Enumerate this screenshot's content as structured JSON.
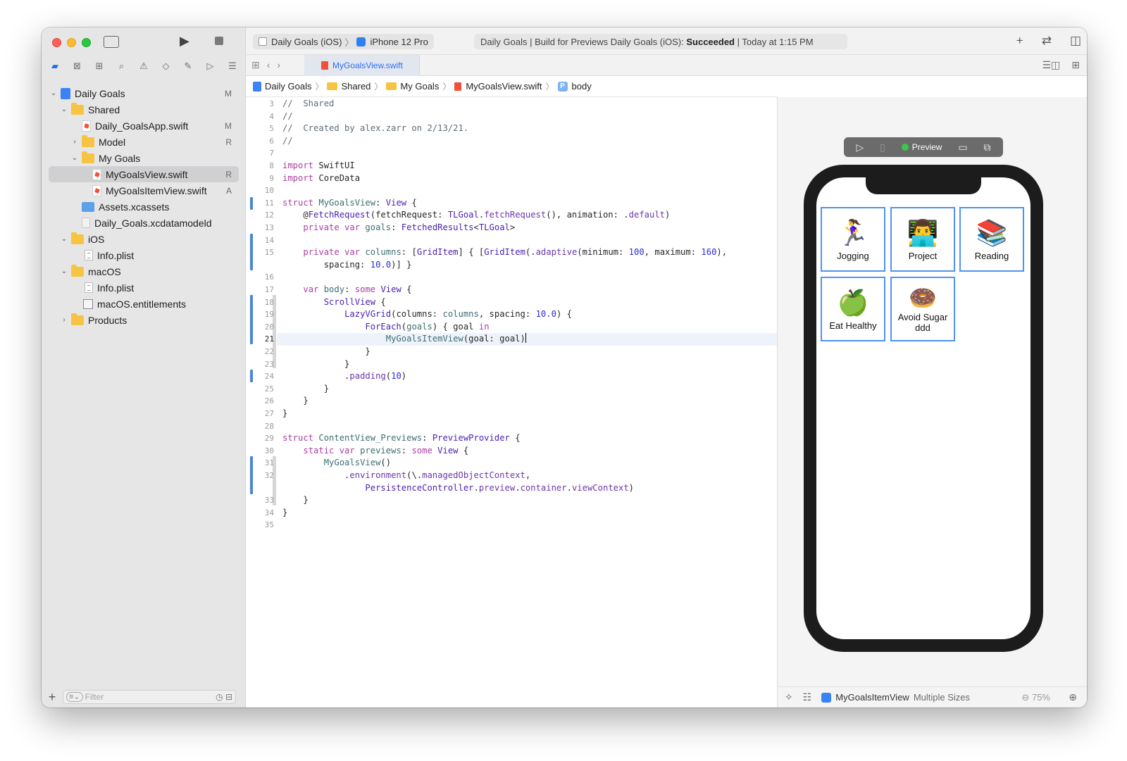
{
  "sidebar": {
    "nav_icons": [
      "folder-icon",
      "source-control-icon",
      "symbol-icon",
      "find-icon",
      "issue-icon",
      "test-icon",
      "debug-icon",
      "breakpoint-icon",
      "report-icon"
    ],
    "tree": [
      {
        "label": "Daily Goals",
        "badge": "M",
        "icon": "project-icon"
      },
      {
        "label": "Shared",
        "badge": "",
        "icon": "folder-icon"
      },
      {
        "label": "Daily_GoalsApp.swift",
        "badge": "M",
        "icon": "swift-file-icon"
      },
      {
        "label": "Model",
        "badge": "R",
        "icon": "folder-icon"
      },
      {
        "label": "My Goals",
        "badge": "",
        "icon": "folder-icon"
      },
      {
        "label": "MyGoalsView.swift",
        "badge": "R",
        "icon": "swift-file-icon"
      },
      {
        "label": "MyGoalsItemView.swift",
        "badge": "A",
        "icon": "swift-file-icon"
      },
      {
        "label": "Assets.xcassets",
        "badge": "",
        "icon": "assets-icon"
      },
      {
        "label": "Daily_Goals.xcdatamodeld",
        "badge": "",
        "icon": "data-model-icon"
      },
      {
        "label": "iOS",
        "badge": "",
        "icon": "folder-icon"
      },
      {
        "label": "Info.plist",
        "badge": "",
        "icon": "plist-icon"
      },
      {
        "label": "macOS",
        "badge": "",
        "icon": "folder-icon"
      },
      {
        "label": "Info.plist",
        "badge": "",
        "icon": "plist-icon"
      },
      {
        "label": "macOS.entitlements",
        "badge": "",
        "icon": "entitlements-icon"
      },
      {
        "label": "Products",
        "badge": "",
        "icon": "folder-icon"
      }
    ],
    "filter_placeholder": "Filter"
  },
  "toolbar": {
    "scheme": "Daily Goals (iOS)",
    "device": "iPhone 12 Pro",
    "status_prefix": "Daily Goals | Build for Previews Daily Goals (iOS): ",
    "status_bold": "Succeeded",
    "status_suffix": " | Today at 1:15 PM"
  },
  "tab": {
    "label": "MyGoalsView.swift"
  },
  "jumpbar": [
    "Daily Goals",
    "Shared",
    "My Goals",
    "MyGoalsView.swift",
    "body"
  ],
  "editor": {
    "line_numbers": [
      "3",
      "4",
      "5",
      "6",
      "7",
      "8",
      "9",
      "10",
      "11",
      "12",
      "13",
      "14",
      "15",
      "",
      "16",
      "17",
      "18",
      "19",
      "20",
      "21",
      "22",
      "23",
      "24",
      "25",
      "26",
      "27",
      "28",
      "29",
      "30",
      "31",
      "32",
      "",
      "33",
      "34",
      "35"
    ],
    "current_line": "21"
  },
  "canvas": {
    "preview_label": "Preview",
    "tiles": [
      {
        "emoji": "🏃‍♀️",
        "label": "Jogging"
      },
      {
        "emoji": "👨‍💻",
        "label": "Project"
      },
      {
        "emoji": "📚",
        "label": "Reading"
      },
      {
        "emoji": "🍏",
        "label": "Eat Healthy"
      },
      {
        "emoji": "🍩",
        "label": "Avoid Sugar ddd"
      }
    ],
    "bottom": {
      "view_name": "MyGoalsItemView",
      "modifier": "Multiple Sizes",
      "zoom": "75%"
    }
  },
  "colors": {
    "accent": "#2e6ff2",
    "tile_border": "#4f93ef",
    "keyword": "#ad3da4",
    "type": "#4b21b0"
  }
}
